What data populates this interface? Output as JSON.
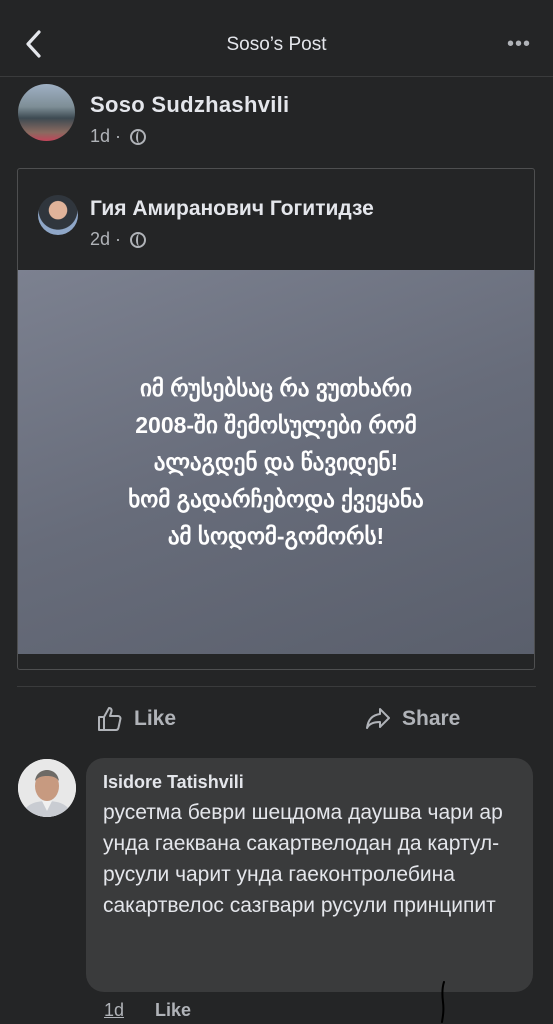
{
  "header": {
    "title": "Soso’s Post",
    "back_icon": "chevron-left-icon",
    "more_label": "•••"
  },
  "post": {
    "author": "Soso  Sudzhashvili",
    "time": "1d",
    "separator": "·",
    "privacy_icon": "globe-icon"
  },
  "shared_post": {
    "author": "Гия Амиранович Гогитидзе",
    "time": "2d",
    "separator": "·",
    "privacy_icon": "globe-icon",
    "image_text": "იმ რუსებსაც რა ვუთხარი\n2008-ში შემოსულები რომ\nალაგდენ და წავიდენ!\nხომ გადარჩებოდა ქვეყანა\nამ სოდომ-გომორს!"
  },
  "actions": {
    "like_label": "Like",
    "share_label": "Share"
  },
  "comment": {
    "author": "Isidore Tatishvili",
    "text": "русетма беври шецдома даушва чари ар унда гаеквана сакартвелодан да картул-русули чарит унда гаеконтролебина сакартвелос сазгвари русули принципит",
    "time": "1d",
    "like_label": "Like"
  }
}
